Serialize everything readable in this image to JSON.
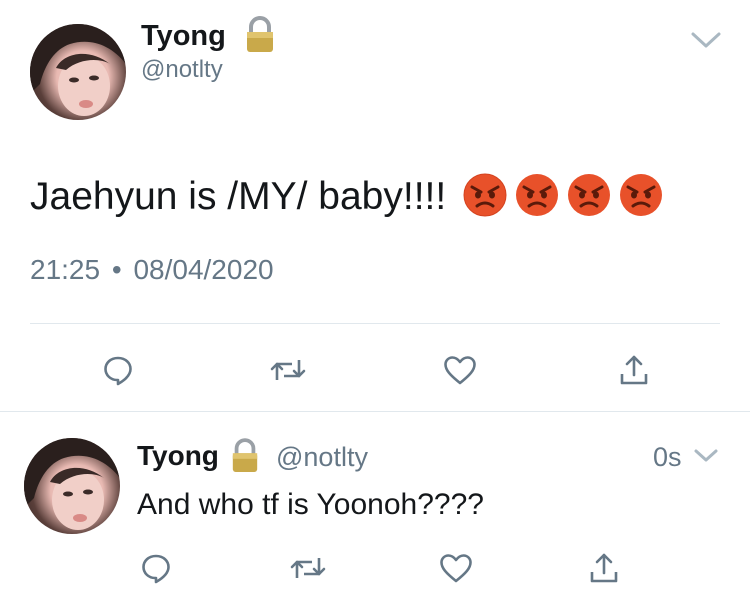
{
  "main_tweet": {
    "author_name": "Tyong",
    "author_handle": "@notlty",
    "text": "Jaehyun is /MY/ baby!!!!",
    "emojis": [
      "angry-face-emoji",
      "angry-face-emoji",
      "angry-face-emoji",
      "angry-face-emoji"
    ],
    "time": "21:25",
    "separator": "•",
    "date": "08/04/2020"
  },
  "reply_tweet": {
    "author_name": "Tyong",
    "author_handle": "@notlty",
    "age": "0s",
    "text": "And who tf is Yoonoh????"
  },
  "actions": [
    "reply-icon",
    "retweet-icon",
    "like-icon",
    "share-icon"
  ],
  "colors": {
    "text": "#14171a",
    "muted": "#657786",
    "divider": "#e1e8ed",
    "icon": "#657786",
    "lock": "#c9a94a",
    "emoji_angry": "#e8512a"
  }
}
